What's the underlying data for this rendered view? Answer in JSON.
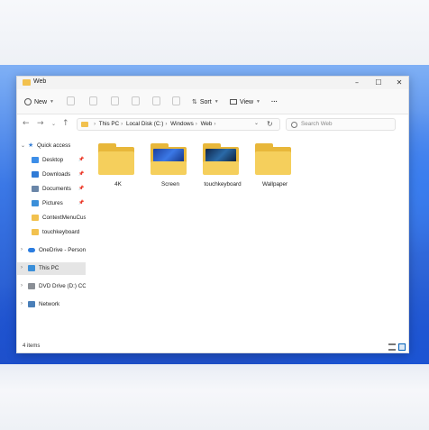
{
  "window": {
    "title": "Web"
  },
  "toolbar": {
    "new_label": "New",
    "sort_label": "Sort",
    "view_label": "View",
    "more_label": "···"
  },
  "address": {
    "crumbs": [
      "This PC",
      "Local Disk (C:)",
      "Windows",
      "Web"
    ],
    "search_placeholder": "Search Web"
  },
  "sidebar": {
    "quick_access": "Quick access",
    "items": [
      {
        "label": "Desktop",
        "icon": "desktop-icon",
        "color": "#3d8ee8"
      },
      {
        "label": "Downloads",
        "icon": "download-icon",
        "color": "#2f7bd6"
      },
      {
        "label": "Documents",
        "icon": "document-icon",
        "color": "#6a86a8"
      },
      {
        "label": "Pictures",
        "icon": "pictures-icon",
        "color": "#3b8fd9"
      },
      {
        "label": "ContextMenuCust",
        "icon": "folder-icon",
        "color": "#f2c14e"
      },
      {
        "label": "touchkeyboard",
        "icon": "folder-icon",
        "color": "#f2c14e"
      }
    ],
    "onedrive": "OneDrive - Personal",
    "this_pc": "This PC",
    "dvd": "DVD Drive (D:) CCCC",
    "network": "Network"
  },
  "folders": [
    {
      "name": "4K",
      "thumb": null
    },
    {
      "name": "Screen",
      "thumb": "#2a4fb8"
    },
    {
      "name": "touchkeyboard",
      "thumb": "#1c3a6a"
    },
    {
      "name": "Wallpaper",
      "thumb": null
    }
  ],
  "status": {
    "item_count": "4 items"
  },
  "colors": {
    "accent": "#005fb8",
    "folder": "#f5cf5c"
  }
}
